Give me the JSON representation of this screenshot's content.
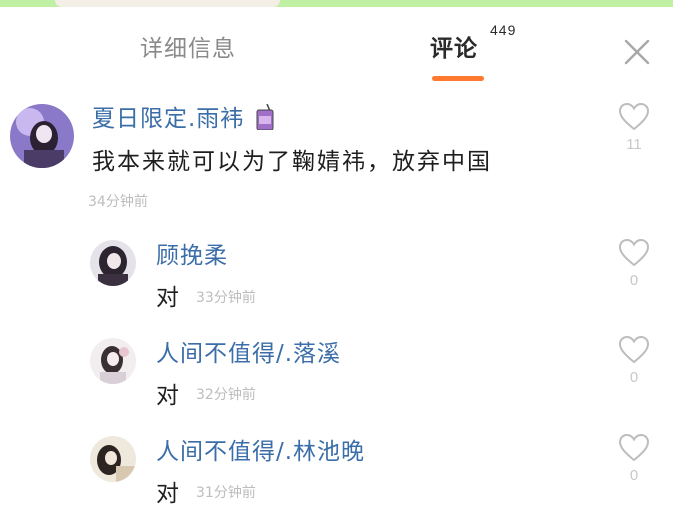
{
  "tabs": [
    {
      "label": "详细信息"
    },
    {
      "label": "评论",
      "count": "449"
    }
  ],
  "comment": {
    "username": "夏日限定.雨袆",
    "text": "我本来就可以为了鞠婧祎，放弃中国",
    "time": "34分钟前",
    "likes": "11"
  },
  "replies": [
    {
      "username": "顾挽柔",
      "text": "对",
      "time": "33分钟前",
      "likes": "0"
    },
    {
      "username": "人间不值得/.落溪",
      "text": "对",
      "time": "32分钟前",
      "likes": "0"
    },
    {
      "username": "人间不值得/.林池晚",
      "text": "对",
      "time": "31分钟前",
      "likes": "0"
    }
  ],
  "colors": {
    "accent": "#ff7a2f",
    "username": "#3b6ea8",
    "top_strip": "#bff0a4"
  }
}
